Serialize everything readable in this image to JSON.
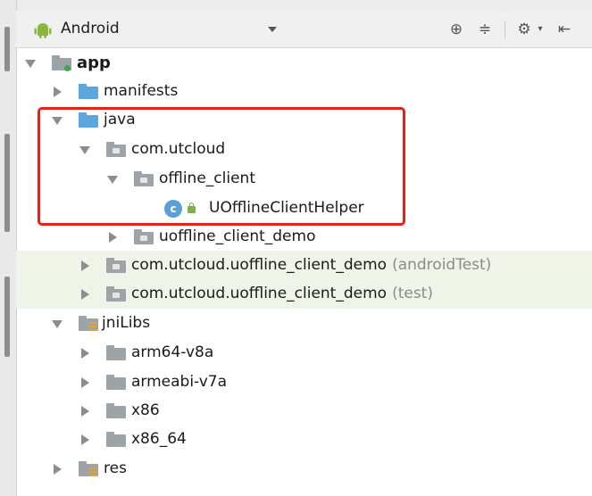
{
  "toolbar": {
    "view_selector": "Android",
    "icons": [
      "target-icon",
      "collapse-all-icon",
      "settings-icon",
      "hide-panel-icon"
    ]
  },
  "tree": {
    "app": "app",
    "manifests": "manifests",
    "java": "java",
    "com_utcloud": "com.utcloud",
    "offline_client": "offline_client",
    "helper_class": "UOfflineClientHelper",
    "class_badge": "c",
    "uoffline_demo": "uoffline_client_demo",
    "pkg_android_test": {
      "name": "com.utcloud.uoffline_client_demo",
      "suffix": "(androidTest)"
    },
    "pkg_test": {
      "name": "com.utcloud.uoffline_client_demo",
      "suffix": "(test)"
    },
    "jniLibs": "jniLibs",
    "arm64": "arm64-v8a",
    "armeabi": "armeabi-v7a",
    "x86": "x86",
    "x86_64": "x86_64",
    "res": "res"
  },
  "colors": {
    "highlight_box": "#e2231a",
    "test_row_bg": "#eef5e8",
    "source_folder": "#5ba6de"
  }
}
